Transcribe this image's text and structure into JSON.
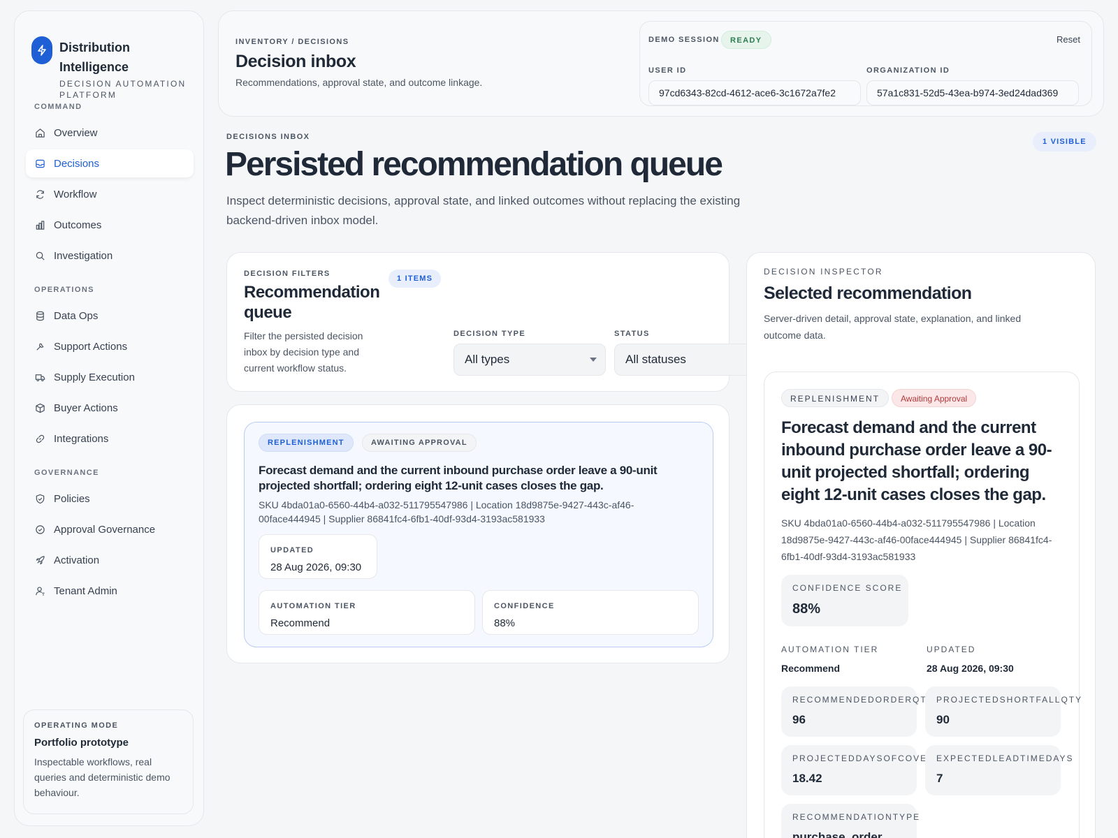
{
  "sidebar": {
    "brand": {
      "name": "Distribution Intelligence",
      "tagline": "DECISION AUTOMATION PLATFORM",
      "icon": "bolt-icon"
    },
    "sections": [
      {
        "title": "COMMAND",
        "items": [
          {
            "label": "Overview",
            "icon": "home-icon",
            "active": false
          },
          {
            "label": "Decisions",
            "icon": "inbox-icon",
            "active": true
          },
          {
            "label": "Workflow",
            "icon": "refresh-icon",
            "active": false
          },
          {
            "label": "Outcomes",
            "icon": "bar-chart-icon",
            "active": false
          },
          {
            "label": "Investigation",
            "icon": "search-icon",
            "active": false
          }
        ]
      },
      {
        "title": "OPERATIONS",
        "items": [
          {
            "label": "Data Ops",
            "icon": "database-icon",
            "active": false
          },
          {
            "label": "Support Actions",
            "icon": "tool-icon",
            "active": false
          },
          {
            "label": "Supply Execution",
            "icon": "truck-icon",
            "active": false
          },
          {
            "label": "Buyer Actions",
            "icon": "package-icon",
            "active": false
          },
          {
            "label": "Integrations",
            "icon": "link-icon",
            "active": false
          }
        ]
      },
      {
        "title": "GOVERNANCE",
        "items": [
          {
            "label": "Policies",
            "icon": "shield-icon",
            "active": false
          },
          {
            "label": "Approval Governance",
            "icon": "check-circle-icon",
            "active": false
          },
          {
            "label": "Activation",
            "icon": "rocket-icon",
            "active": false
          },
          {
            "label": "Tenant Admin",
            "icon": "user-admin-icon",
            "active": false
          }
        ]
      }
    ],
    "operating_mode": {
      "eyebrow": "OPERATING MODE",
      "title": "Portfolio prototype",
      "description": "Inspectable workflows, real queries and deterministic demo behaviour."
    }
  },
  "header": {
    "breadcrumb": "INVENTORY / DECISIONS",
    "title": "Decision inbox",
    "subtitle": "Recommendations, approval state, and outcome linkage.",
    "demo": {
      "label": "DEMO SESSION",
      "status": "READY",
      "reset_label": "Reset",
      "user_id_label": "USER ID",
      "user_id": "97cd6343-82cd-4612-ace6-3c1672a7fe2",
      "org_id_label": "ORGANIZATION ID",
      "org_id": "57a1c831-52d5-43ea-b974-3ed24dad369"
    }
  },
  "hero": {
    "eyebrow": "DECISIONS INBOX",
    "title": "Persisted recommendation queue",
    "description": "Inspect deterministic decisions, approval state, and linked outcomes without replacing the existing backend-driven inbox model.",
    "visible_badge": "1 VISIBLE"
  },
  "filters": {
    "eyebrow": "DECISION FILTERS",
    "title": "Recommendation queue",
    "items_badge": "1 ITEMS",
    "description": "Filter the persisted decision inbox by decision type and current workflow status.",
    "type_label": "DECISION TYPE",
    "type_value": "All types",
    "status_label": "STATUS",
    "status_value": "All statuses"
  },
  "queue": {
    "items": [
      {
        "type": "REPLENISHMENT",
        "status": "AWAITING APPROVAL",
        "title": "Forecast demand and the current inbound purchase order leave a 90-unit projected shortfall; ordering eight 12-unit cases closes the gap.",
        "meta": "SKU 4bda01a0-6560-44b4-a032-511795547986 | Location 18d9875e-9427-443c-af46-00face444945 | Supplier 86841fc4-6fb1-40df-93d4-3193ac581933",
        "updated_label": "UPDATED",
        "updated": "28 Aug 2026, 09:30",
        "tier_label": "AUTOMATION TIER",
        "tier": "Recommend",
        "confidence_label": "CONFIDENCE",
        "confidence": "88%"
      }
    ]
  },
  "inspector": {
    "eyebrow": "DECISION INSPECTOR",
    "title": "Selected recommendation",
    "description": "Server-driven detail, approval state, explanation, and linked outcome data.",
    "type": "REPLENISHMENT",
    "status": "Awaiting Approval",
    "rec_title": "Forecast demand and the current inbound purchase order leave a 90-unit projected shortfall; ordering eight 12-unit cases closes the gap.",
    "meta": "SKU 4bda01a0-6560-44b4-a032-511795547986 | Location 18d9875e-9427-443c-af46-00face444945 | Supplier 86841fc4-6fb1-40df-93d4-3193ac581933",
    "confidence_label": "CONFIDENCE SCORE",
    "confidence": "88%",
    "tier_label": "AUTOMATION TIER",
    "tier": "Recommend",
    "updated_label": "UPDATED",
    "updated": "28 Aug 2026, 09:30",
    "metrics": [
      {
        "label": "RECOMMENDEDORDERQTY",
        "value": "96"
      },
      {
        "label": "PROJECTEDSHORTFALLQTY",
        "value": "90"
      },
      {
        "label": "PROJECTEDDAYSOFCOVER",
        "value": "18.42"
      },
      {
        "label": "EXPECTEDLEADTIMEDAYS",
        "value": "7"
      },
      {
        "label": "RECOMMENDATIONTYPE",
        "value": "purchase_order"
      }
    ]
  },
  "colors": {
    "accent": "#1f5fd6",
    "ready": "#2e7d4f",
    "awaiting": "#b0383a",
    "background": "#f5f6f8"
  }
}
